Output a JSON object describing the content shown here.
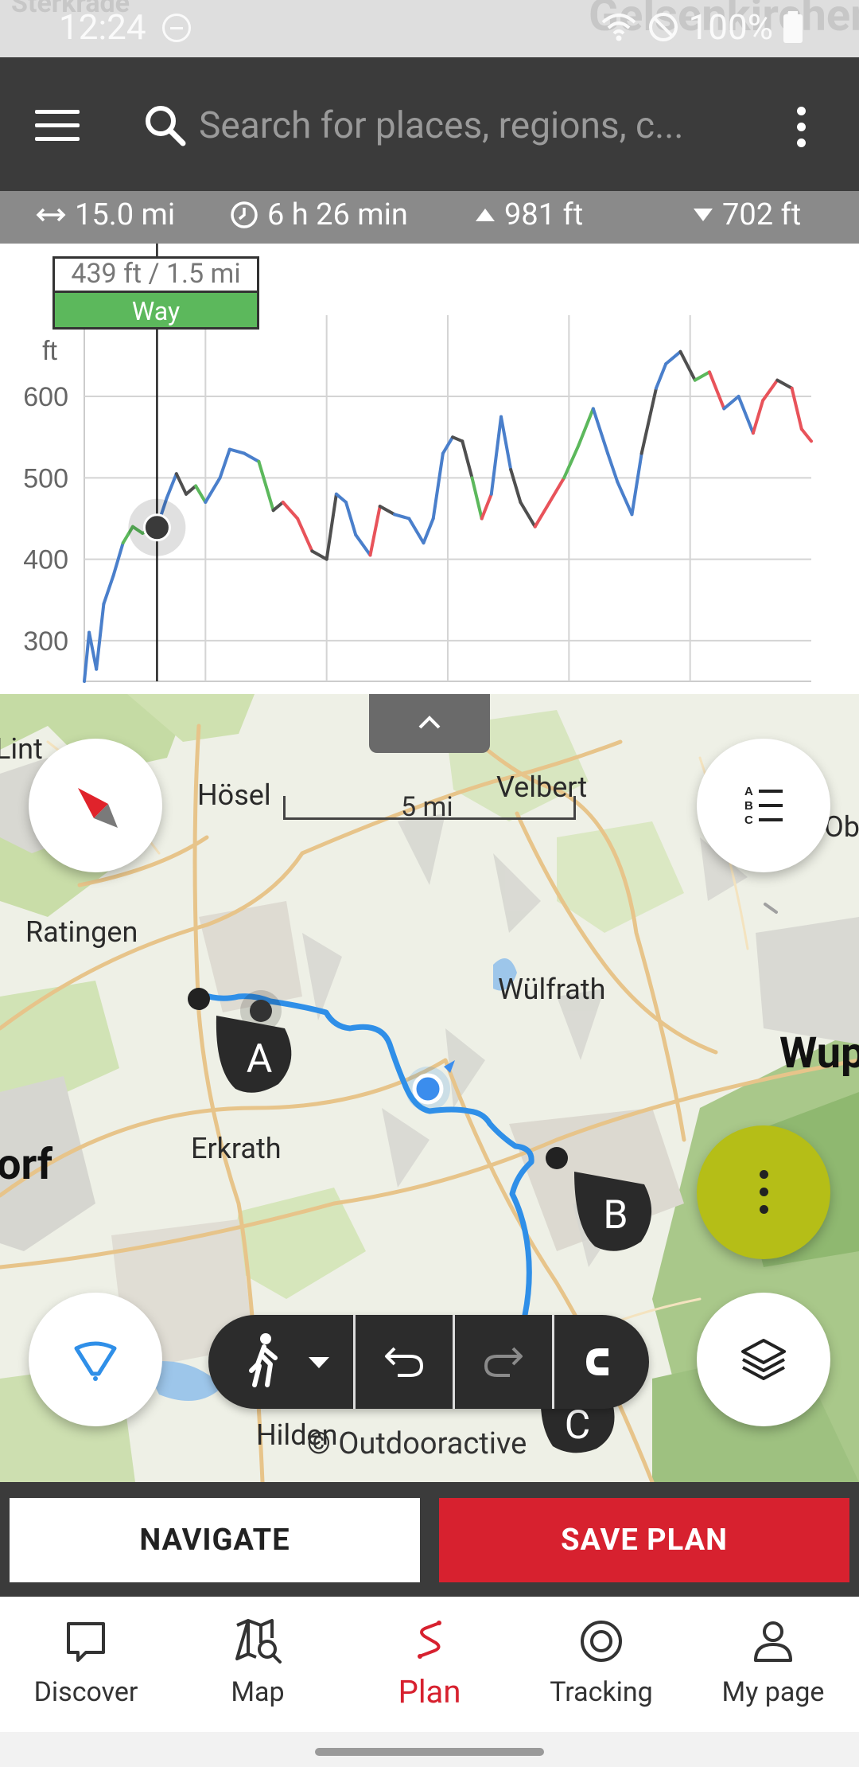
{
  "status": {
    "time": "12:24",
    "battery": "100%",
    "bg_left": "Sterkrade",
    "bg_right": "Gelsenkirchen"
  },
  "search": {
    "placeholder": "Search for places, regions, c..."
  },
  "stats": {
    "distance": "15.0 mi",
    "duration": "6 h 26 min",
    "ascent": "981 ft",
    "descent": "702 ft"
  },
  "tooltip": {
    "value": "439 ft / 1.5 mi",
    "surface": "Way"
  },
  "chart_data": {
    "type": "line",
    "title": "",
    "xlabel": "",
    "ylabel": "ft",
    "ylim": [
      250,
      690
    ],
    "yticks": [
      300,
      400,
      500,
      600
    ],
    "x_unit": "mi",
    "xlim": [
      0,
      15.0
    ],
    "grid": true,
    "cursor_x": 1.5,
    "cursor_y": 439,
    "x": [
      0,
      0.1,
      0.25,
      0.4,
      0.6,
      0.8,
      1.0,
      1.2,
      1.5,
      1.7,
      1.9,
      2.1,
      2.3,
      2.5,
      2.8,
      3.0,
      3.3,
      3.6,
      3.9,
      4.1,
      4.4,
      4.7,
      5.0,
      5.2,
      5.4,
      5.6,
      5.9,
      6.1,
      6.4,
      6.7,
      7.0,
      7.2,
      7.4,
      7.6,
      7.8,
      8.0,
      8.2,
      8.4,
      8.6,
      8.8,
      9.0,
      9.3,
      9.6,
      9.9,
      10.2,
      10.5,
      10.8,
      11.0,
      11.3,
      11.5,
      11.8,
      12.0,
      12.3,
      12.6,
      12.9,
      13.2,
      13.5,
      13.8,
      14.0,
      14.3,
      14.6,
      14.8,
      15.0
    ],
    "y": [
      250,
      310,
      265,
      345,
      380,
      420,
      440,
      432,
      439,
      475,
      505,
      480,
      490,
      470,
      500,
      535,
      530,
      520,
      460,
      470,
      450,
      410,
      400,
      480,
      470,
      430,
      405,
      465,
      455,
      450,
      420,
      450,
      530,
      550,
      545,
      500,
      450,
      480,
      575,
      510,
      470,
      440,
      470,
      500,
      540,
      585,
      530,
      495,
      455,
      530,
      610,
      640,
      655,
      620,
      630,
      585,
      600,
      555,
      595,
      620,
      610,
      560,
      545
    ],
    "surface_colors": {
      "way": "#5cb85c",
      "path": "#4f4f4f",
      "road": "#e8535a",
      "default": "#4a7fcb"
    }
  },
  "map": {
    "labels": {
      "hosel": "Hösel",
      "velbert": "Velbert",
      "ratingen": "Ratingen",
      "wulfrath": "Wülfrath",
      "wuppertal": "Wup",
      "erkrath": "Erkrath",
      "hilden": "Hilden",
      "lintorf": "Lint",
      "dusseldorf": "orf",
      "ober": "Obe"
    },
    "scale": "5 mi",
    "attribution": "© Outdooractive",
    "markers": [
      "A",
      "B",
      "C"
    ]
  },
  "actions": {
    "navigate": "NAVIGATE",
    "save_plan": "SAVE PLAN"
  },
  "nav": {
    "items": [
      {
        "label": "Discover",
        "icon": "comment-icon"
      },
      {
        "label": "Map",
        "icon": "map-search-icon"
      },
      {
        "label": "Plan",
        "icon": "plan-route-icon"
      },
      {
        "label": "Tracking",
        "icon": "tracking-icon"
      },
      {
        "label": "My page",
        "icon": "user-icon"
      }
    ],
    "active": "Plan"
  },
  "colors": {
    "accent": "#d7212f",
    "appbar": "#3b3b3b",
    "route": "#2f8fe8",
    "fab": "#b5be17"
  }
}
